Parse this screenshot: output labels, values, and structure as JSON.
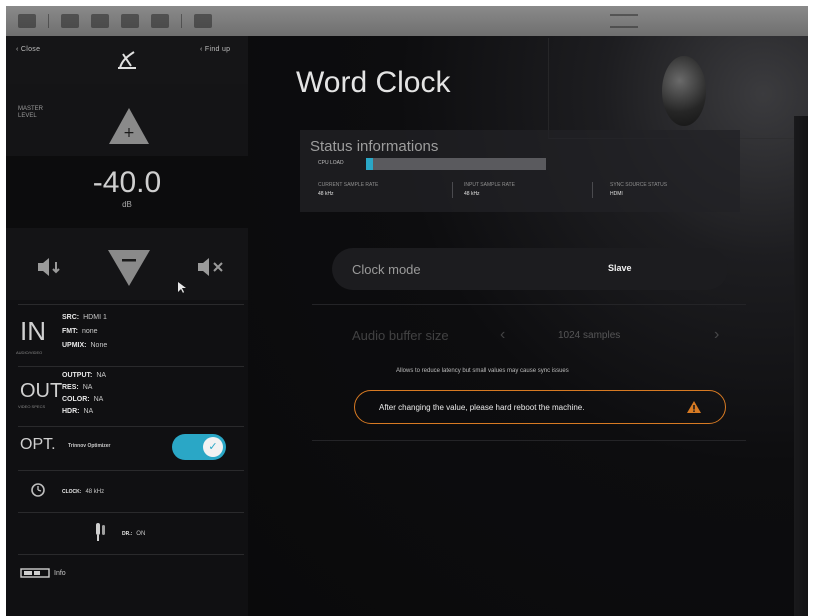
{
  "colors": {
    "accent": "#2aa7c6",
    "warning": "#d77a23",
    "background": "#0a0a0b"
  },
  "left_panel": {
    "close_label": "Close",
    "find_up_label": "Find up",
    "logo_icon": "logo-icon",
    "master_level_label": "MASTER LEVEL",
    "volume_value": "-40.0",
    "volume_unit": "dB",
    "input": {
      "big_label": "IN",
      "sub_label": "AUDIO/VIDEO",
      "src_key": "SRC:",
      "src_value": "HDMI 1",
      "fmt_key": "FMT:",
      "fmt_value": "none",
      "upmix_key": "UPMIX:",
      "upmix_value": "None"
    },
    "output": {
      "big_label": "OUT",
      "sub_label": "VIDEO SPECS",
      "output_key": "OUTPUT:",
      "output_value": "NA",
      "res_key": "RES:",
      "res_value": "NA",
      "color_key": "COLOR:",
      "color_value": "NA",
      "hdr_key": "HDR:",
      "hdr_value": "NA"
    },
    "optimizer": {
      "big_label": "OPT.",
      "label": "Trinnov Optimizer",
      "enabled": true
    },
    "clock": {
      "key": "CLOCK:",
      "value": "48 kHz"
    },
    "dr": {
      "key": "DR.:",
      "value": "ON"
    },
    "info_label": "Info"
  },
  "main": {
    "title": "Word Clock",
    "status": {
      "title": "Status informations",
      "load_label": "CPU LOAD",
      "load_percent": 4,
      "current_rate_label": "CURRENT SAMPLE RATE",
      "current_rate_value": "48 kHz",
      "input_rate_label": "INPUT SAMPLE RATE",
      "input_rate_value": "48 kHz",
      "sync_label": "SYNC SOURCE STATUS",
      "sync_value": "HDMI"
    },
    "clock_mode": {
      "label": "Clock mode",
      "value": "Slave"
    },
    "buffer": {
      "label": "Audio buffer size",
      "value": "1024 samples",
      "prev": "‹",
      "next": "›"
    },
    "hint": "Allows to reduce latency but small values may cause sync issues",
    "warning": "After changing the value, please hard reboot the machine."
  }
}
